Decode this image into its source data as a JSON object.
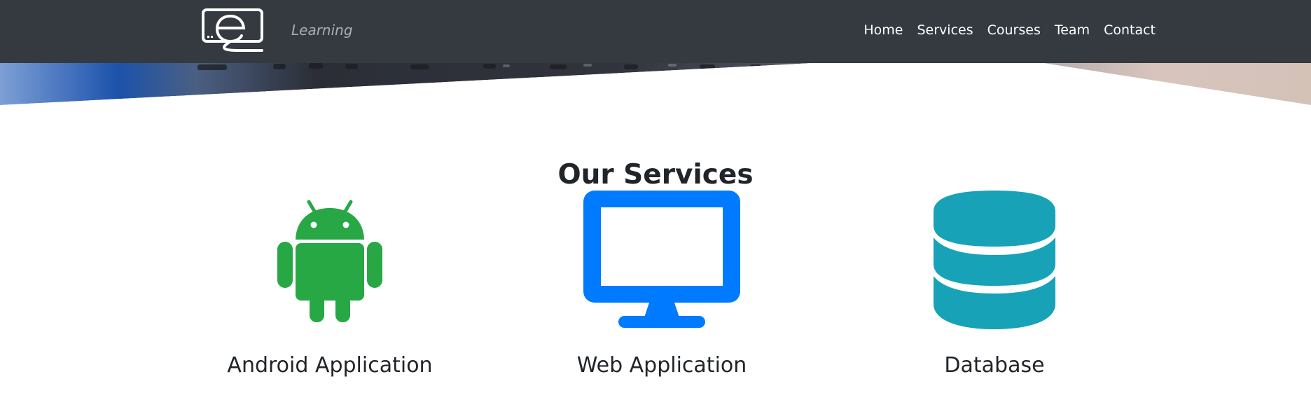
{
  "brand": {
    "logo_icon": "e-monitor-logo",
    "tagline": "Learning"
  },
  "nav": {
    "items": [
      {
        "label": "Home"
      },
      {
        "label": "Services"
      },
      {
        "label": "Courses"
      },
      {
        "label": "Team"
      },
      {
        "label": "Contact"
      }
    ]
  },
  "services": {
    "title": "Our Services",
    "items": [
      {
        "label": "Android Application",
        "icon": "android-icon",
        "color": "#28a745"
      },
      {
        "label": "Web Application",
        "icon": "monitor-icon",
        "color": "#007bff"
      },
      {
        "label": "Database",
        "icon": "database-icon",
        "color": "#17a2b8"
      }
    ]
  },
  "colors": {
    "navbar": "#343a40",
    "text": "#212529"
  }
}
